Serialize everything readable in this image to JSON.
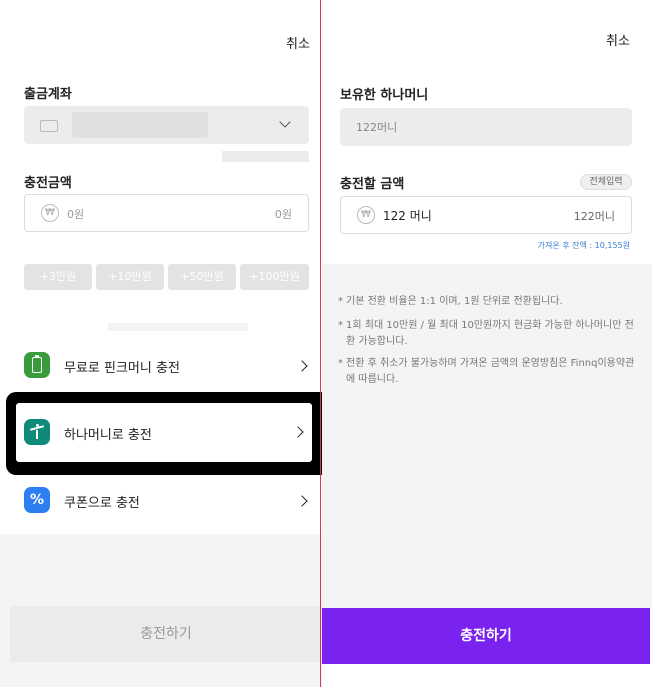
{
  "left": {
    "cancel": "취소",
    "account_label": "출금계좌",
    "amount_label": "충전금액",
    "amount_placeholder": "0원",
    "amount_suffix": "0원",
    "won_symbol": "₩",
    "quick_chips": [
      "+3만원",
      "+10만원",
      "+50만원",
      "+100만원"
    ],
    "menu": [
      {
        "label": "무료로 핀크머니 충전",
        "icon": "battery-icon"
      },
      {
        "label": "하나머니로 충전",
        "icon": "hana-logo-icon"
      },
      {
        "label": "쿠폰으로 충전",
        "icon": "percent-icon",
        "glyph": "%"
      }
    ],
    "submit_label": "충전하기"
  },
  "right": {
    "cancel": "취소",
    "owned_label": "보유한 하나머니",
    "owned_value": "122머니",
    "charge_label": "충전할 금액",
    "full_input_label": "전체입력",
    "charge_value": "122 머니",
    "charge_suffix": "122머니",
    "balance_note": "가져온 후 잔액 : 10,155원",
    "notices": [
      "기본 전환 비율은 1:1 이며, 1원 단위로 전환됩니다.",
      "1회 최대 10만원 / 월 최대 10만원까지 현금화 가능한 하나머니만 전환 가능합니다.",
      "전환 후 취소가 불가능하며 가져온 금액의 운영방침은 Finnq이용약관에 따릅니다."
    ],
    "submit_label": "충전하기"
  },
  "colors": {
    "accent_purple": "#7a22f0",
    "hana_green": "#0f8a7a",
    "battery_green": "#3a9b3c",
    "coupon_blue": "#2d7ef0",
    "link_blue": "#3a7fd6",
    "highlight_border": "#000000"
  }
}
